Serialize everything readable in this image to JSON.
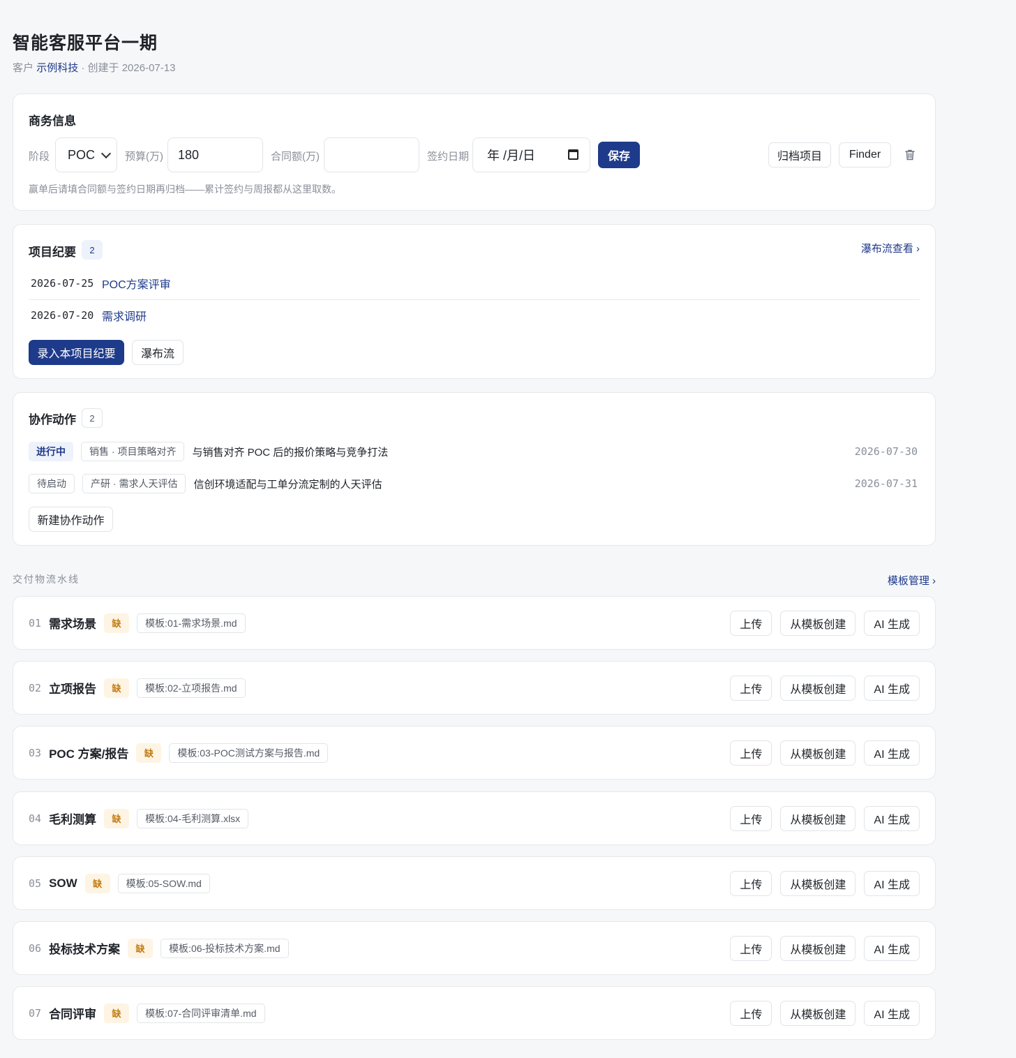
{
  "header": {
    "title": "智能客服平台一期",
    "customer_prefix": "客户",
    "customer_name": "示例科技",
    "created_text": "· 创建于 2026-07-13"
  },
  "business": {
    "title": "商务信息",
    "stage_label": "阶段",
    "stage_value": "POC",
    "budget_label": "预算(万)",
    "budget_value": "180",
    "contract_label": "合同额(万)",
    "contract_value": "",
    "sign_label": "签约日期",
    "sign_placeholder": "年 /月/日",
    "save_label": "保存",
    "archive_label": "归档项目",
    "finder_label": "Finder",
    "hint": "赢单后请填合同额与签约日期再归档——累计签约与周报都从这里取数。"
  },
  "minutes": {
    "title": "项目纪要",
    "count": "2",
    "waterfall_link": "瀑布流查看 ›",
    "items": [
      {
        "date": "2026-07-25",
        "title": "POC方案评审"
      },
      {
        "date": "2026-07-20",
        "title": "需求调研"
      }
    ],
    "add_label": "录入本项目纪要",
    "waterfall_label": "瀑布流"
  },
  "actions": {
    "title": "协作动作",
    "count": "2",
    "items": [
      {
        "status": "进行中",
        "category": "销售 · 项目策略对齐",
        "text": "与销售对齐 POC 后的报价策略与竞争打法",
        "date": "2026-07-30"
      },
      {
        "status": "待启动",
        "category": "产研 · 需求人天评估",
        "text": "信创环境适配与工单分流定制的人天评估",
        "date": "2026-07-31"
      }
    ],
    "new_label": "新建协作动作"
  },
  "pipeline": {
    "label": "交付物流水线",
    "template_link": "模板管理 ›",
    "upload_label": "上传",
    "from_template_label": "从模板创建",
    "ai_label": "AI 生成",
    "missing_label": "缺",
    "stages": [
      {
        "num": "01",
        "name": "需求场景",
        "template": "模板:01-需求场景.md"
      },
      {
        "num": "02",
        "name": "立项报告",
        "template": "模板:02-立项报告.md"
      },
      {
        "num": "03",
        "name": "POC 方案/报告",
        "template": "模板:03-POC测试方案与报告.md"
      },
      {
        "num": "04",
        "name": "毛利测算",
        "template": "模板:04-毛利测算.xlsx"
      },
      {
        "num": "05",
        "name": "SOW",
        "template": "模板:05-SOW.md"
      },
      {
        "num": "06",
        "name": "投标技术方案",
        "template": "模板:06-投标技术方案.md"
      },
      {
        "num": "07",
        "name": "合同评审",
        "template": "模板:07-合同评审清单.md"
      }
    ]
  },
  "colors": {
    "accent": "#1e3a8a",
    "missing": "#c27a12",
    "missing_bg": "#fdf4e3",
    "background": "#f6f7f9"
  }
}
